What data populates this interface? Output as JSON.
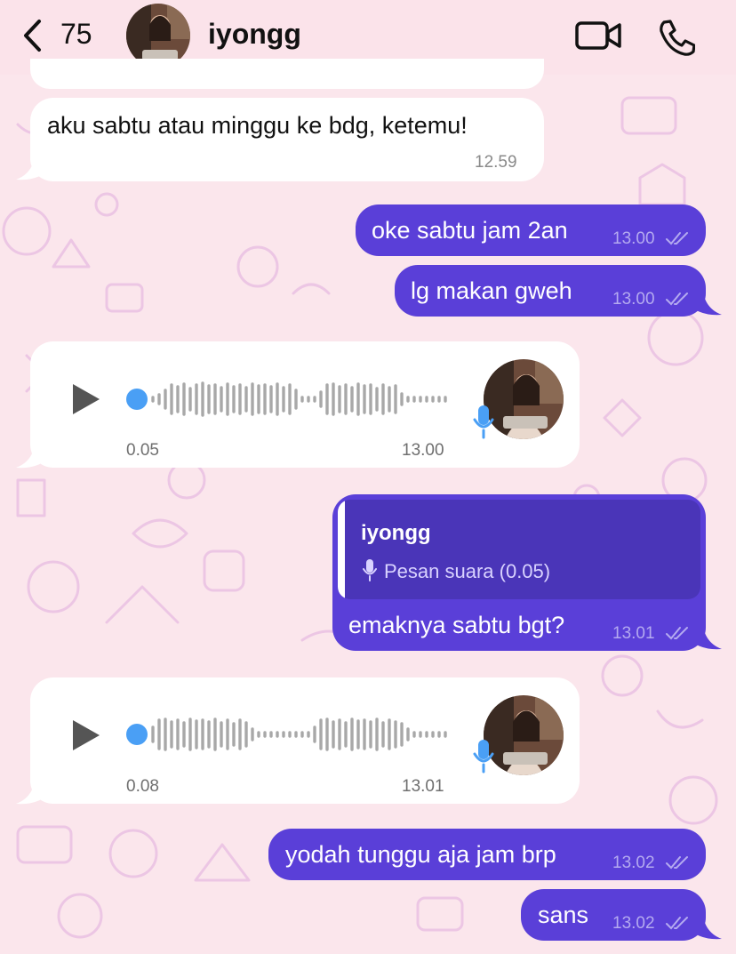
{
  "header": {
    "back_count": "75",
    "contact_name": "iyongg",
    "video_icon": "video-camera-icon",
    "call_icon": "phone-icon"
  },
  "colors": {
    "outgoing_bubble": "#5a3fd8",
    "incoming_bubble": "#ffffff",
    "background": "#fbe6ec",
    "voice_progress": "#4a9ff5"
  },
  "messages": [
    {
      "direction": "in",
      "text": "aku sabtu atau minggu ke bdg, ketemu!",
      "time": "12.59"
    },
    {
      "direction": "out",
      "text": "oke sabtu jam 2an",
      "time": "13.00",
      "status": "read"
    },
    {
      "direction": "out",
      "text": "lg makan gweh",
      "time": "13.00",
      "status": "read"
    },
    {
      "direction": "in",
      "type": "voice",
      "duration": "0.05",
      "time": "13.00"
    },
    {
      "direction": "out",
      "reply_to": {
        "name": "iyongg",
        "text": "Pesan suara (0.05)"
      },
      "text": "emaknya sabtu bgt?",
      "time": "13.01",
      "status": "read"
    },
    {
      "direction": "in",
      "type": "voice",
      "duration": "0.08",
      "time": "13.01"
    },
    {
      "direction": "out",
      "text": "yodah tunggu aja jam brp",
      "time": "13.02",
      "status": "read"
    },
    {
      "direction": "out",
      "text": "sans",
      "time": "13.02",
      "status": "read"
    }
  ]
}
